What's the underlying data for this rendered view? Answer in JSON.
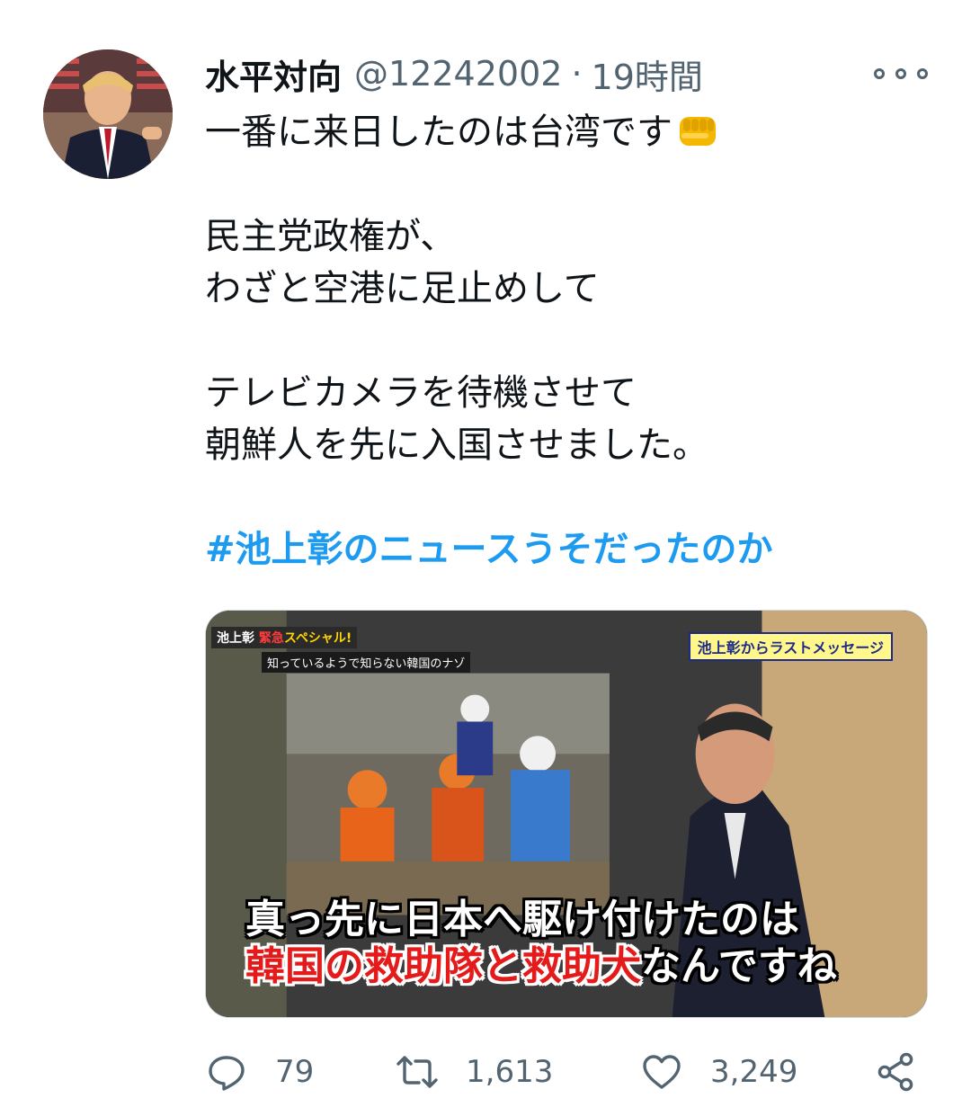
{
  "tweet": {
    "display_name": "水平対向",
    "handle": "@12242002",
    "separator": "·",
    "timestamp": "19時間",
    "lines": [
      "一番に来日したのは台湾です",
      "",
      "民主党政権が、",
      "わざと空港に足止めして",
      "",
      "テレビカメラを待機させて",
      "朝鮮人を先に入国させました。",
      ""
    ],
    "hashtag": "#池上彰のニュースうそだったのか",
    "emoji": "fist-emoji"
  },
  "media": {
    "tag_part1": "池上彰",
    "tag_part2": "緊急",
    "tag_part3": "スペシャル!",
    "sub_caption": "知っているようで知らない韓国のナゾ",
    "corner_caption": "池上彰からラストメッセージ",
    "subtitle_line1": "真っ先に日本へ駆け付けたのは",
    "subtitle_line2_red": "韓国の救助隊と救助犬",
    "subtitle_line2_white": "なんですね"
  },
  "actions": {
    "reply_count": "79",
    "retweet_count": "1,613",
    "like_count": "3,249",
    "icons": [
      "reply-icon",
      "retweet-icon",
      "like-icon",
      "share-icon"
    ]
  },
  "colors": {
    "text": "#0f1419",
    "secondary": "#536471",
    "link": "#1d9bf0"
  }
}
